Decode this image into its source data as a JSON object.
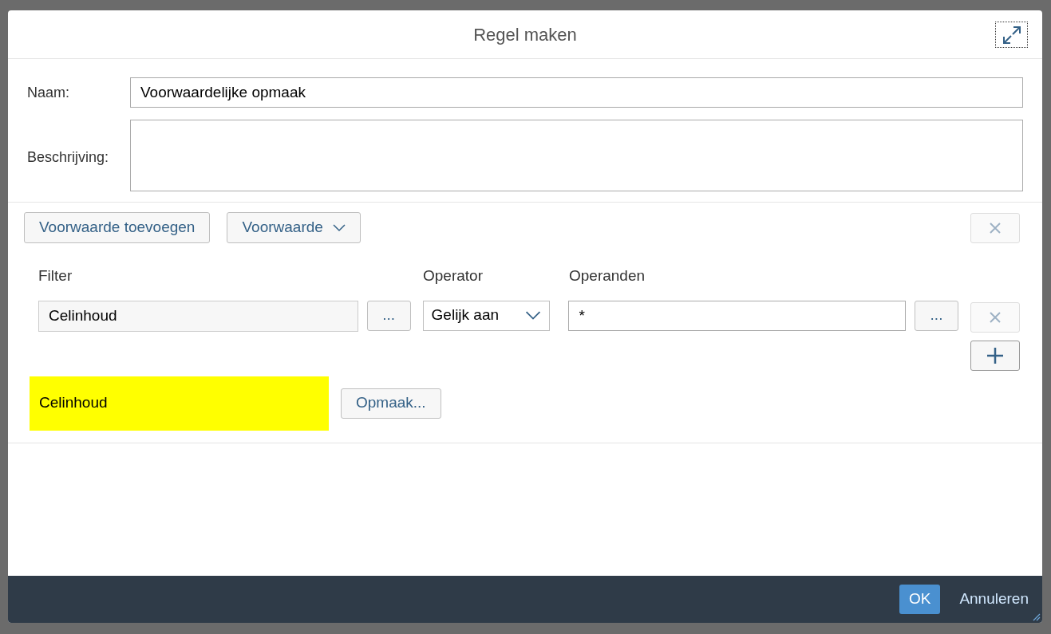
{
  "dialog": {
    "title": "Regel maken"
  },
  "form": {
    "name_label": "Naam:",
    "name_value": "Voorwaardelijke opmaak",
    "description_label": "Beschrijving:"
  },
  "toolbar": {
    "add_button": "Voorwaarde toevoegen",
    "type_dropdown": "Voorwaarde",
    "remove_disabled": true
  },
  "columns": [
    "Filter",
    "Operator",
    "Operanden"
  ],
  "conditions": [
    {
      "filter": "Celinhoud",
      "filter_button": "...",
      "operator": "Gelijk aan",
      "operand": "*",
      "operand_button": "...",
      "remove_disabled": true,
      "add_enabled": true
    }
  ],
  "preview": {
    "text": "Celinhoud",
    "color": "#ffff00",
    "format_button": "Opmaak..."
  },
  "footer": {
    "ok": "OK",
    "cancel": "Annuleren"
  }
}
